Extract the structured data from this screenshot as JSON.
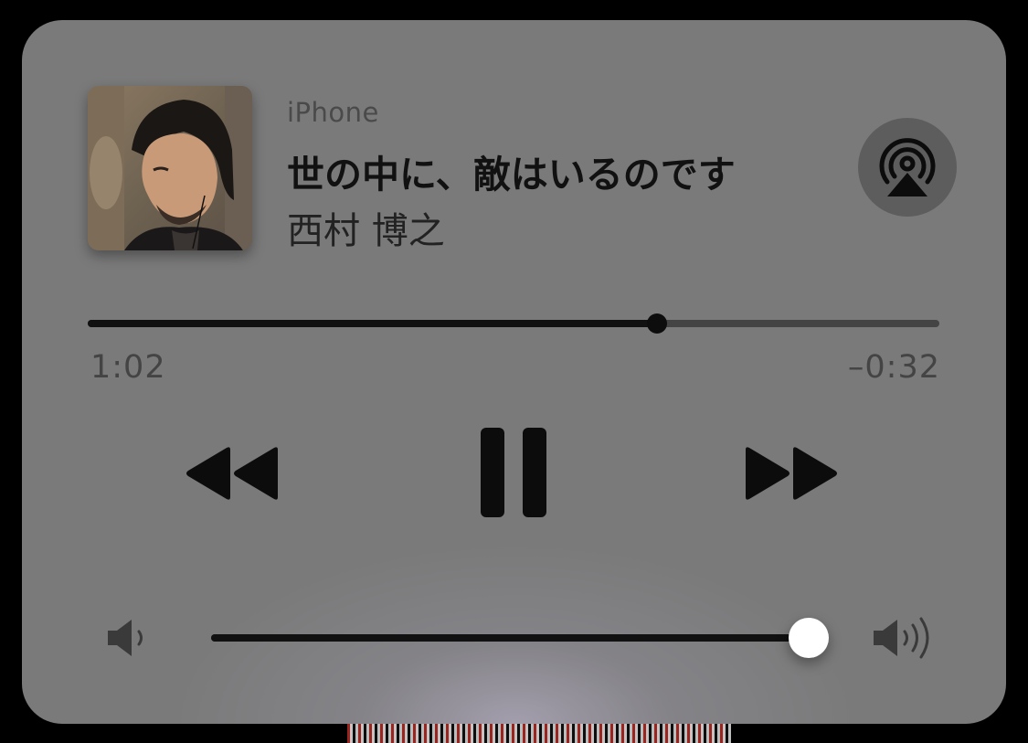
{
  "now_playing": {
    "source": "iPhone",
    "title": "世の中に、敵はいるのです",
    "artist": "西村 博之"
  },
  "playback": {
    "elapsed": "1:02",
    "remaining": "–0:32",
    "progress": 0.668,
    "state": "playing"
  },
  "volume": {
    "level": 1.0
  },
  "icons": {
    "airplay": "airplay-icon",
    "rewind": "rewind-icon",
    "pause": "pause-icon",
    "forward": "fast-forward-icon",
    "volume_min": "speaker-low-icon",
    "volume_max": "speaker-high-icon"
  },
  "colors": {
    "card_background": "#7a7a7a",
    "control_dark": "#111111",
    "track_inactive": "#444444",
    "volume_knob": "#ffffff"
  }
}
